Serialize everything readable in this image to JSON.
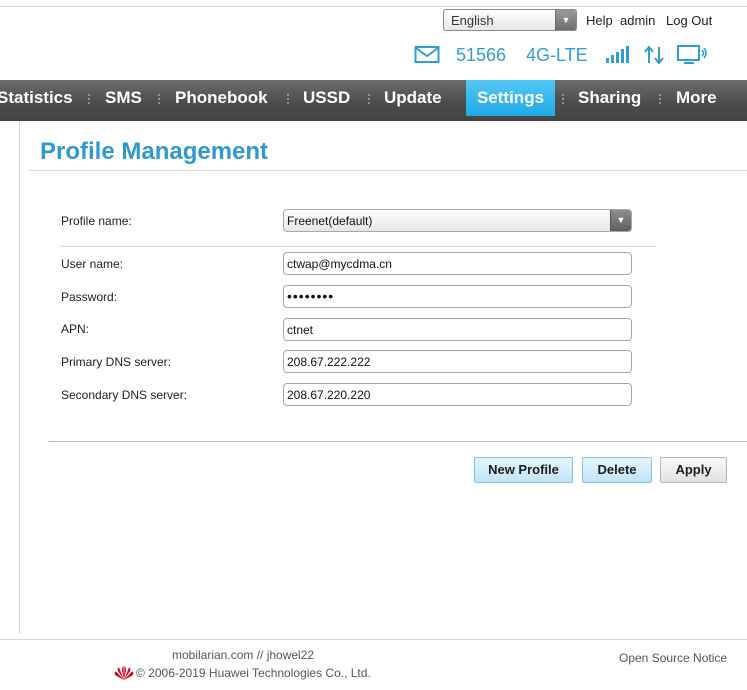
{
  "header": {
    "language": "English",
    "help": "Help",
    "user": "admin",
    "logout": "Log Out"
  },
  "status": {
    "sms_count": "51566",
    "network": "4G-LTE",
    "icons": [
      "mail-icon",
      "signal-bars-icon",
      "data-transfer-icon",
      "computer-connected-icon"
    ],
    "accent": "#2e9fd6"
  },
  "nav": {
    "items": [
      {
        "label": "Statistics"
      },
      {
        "label": "SMS"
      },
      {
        "label": "Phonebook"
      },
      {
        "label": "USSD"
      },
      {
        "label": "Update"
      },
      {
        "label": "Settings",
        "active": true
      },
      {
        "label": "Sharing"
      },
      {
        "label": "More"
      }
    ],
    "active_color": "#1da9e6"
  },
  "page": {
    "title": "Profile Management"
  },
  "form": {
    "profile_name": {
      "label": "Profile name:",
      "value": "Freenet(default)"
    },
    "user_name": {
      "label": "User name:",
      "value": "ctwap@mycdma.cn"
    },
    "password": {
      "label": "Password:",
      "value": "••••••••"
    },
    "apn": {
      "label": "APN:",
      "value": "ctnet"
    },
    "primary_dns": {
      "label": "Primary DNS server:",
      "value": "208.67.222.222"
    },
    "secondary_dns": {
      "label": "Secondary DNS server:",
      "value": "208.67.220.220"
    }
  },
  "buttons": {
    "new_profile": "New Profile",
    "delete": "Delete",
    "apply": "Apply"
  },
  "footer": {
    "credit": "mobilarian.com // jhowel22",
    "copyright": "© 2006-2019 Huawei Technologies Co., Ltd.",
    "open_source": "Open Source Notice",
    "logo_color": "#d9001b"
  }
}
